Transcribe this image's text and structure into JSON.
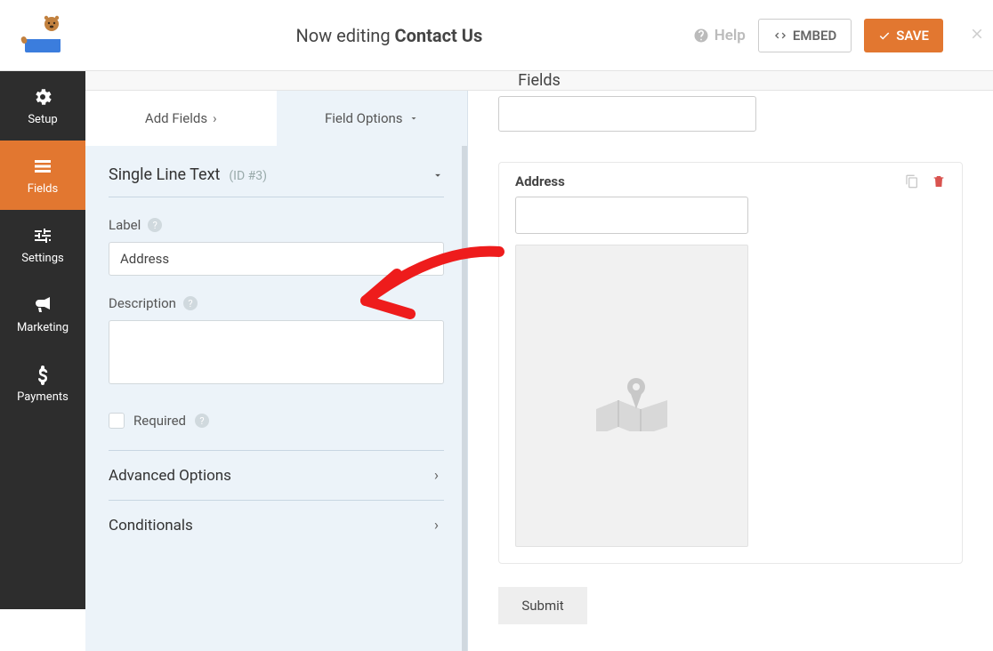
{
  "header": {
    "editing_prefix": "Now editing ",
    "form_name": "Contact Us",
    "help_label": "Help",
    "embed_label": "EMBED",
    "save_label": "SAVE"
  },
  "rail": {
    "setup": "Setup",
    "fields": "Fields",
    "settings": "Settings",
    "marketing": "Marketing",
    "payments": "Payments"
  },
  "section_title": "Fields",
  "panel": {
    "tab_add": "Add Fields",
    "tab_options": "Field Options",
    "field_type": "Single Line Text",
    "field_id": "(ID #3)",
    "label_label": "Label",
    "label_value": "Address",
    "description_label": "Description",
    "description_value": "",
    "required_label": "Required",
    "advanced_label": "Advanced Options",
    "conditionals_label": "Conditionals"
  },
  "preview": {
    "address_label": "Address",
    "submit_label": "Submit"
  }
}
